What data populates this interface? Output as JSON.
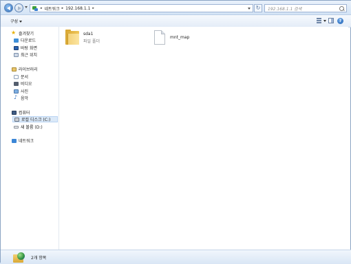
{
  "address": {
    "crumbs": [
      "네트워크",
      "192.168.1.1"
    ],
    "search_placeholder": "192.168.1.1 검색"
  },
  "toolbar": {
    "organize_label": "구성"
  },
  "sidebar": {
    "favorites": {
      "label": "즐겨찾기",
      "items": [
        {
          "label": "다운로드",
          "icon": "download-icon"
        },
        {
          "label": "바탕 화면",
          "icon": "desktop-icon"
        },
        {
          "label": "최근 위치",
          "icon": "recent-places-icon"
        }
      ]
    },
    "libraries": {
      "label": "라이브러리",
      "items": [
        {
          "label": "문서",
          "icon": "documents-icon"
        },
        {
          "label": "비디오",
          "icon": "video-icon"
        },
        {
          "label": "사진",
          "icon": "pictures-icon"
        },
        {
          "label": "음악",
          "icon": "music-icon"
        }
      ]
    },
    "computer": {
      "label": "컴퓨터",
      "items": [
        {
          "label": "로컬 디스크 (C:)",
          "icon": "local-disk-icon",
          "selected": true
        },
        {
          "label": "새 볼륨 (D:)",
          "icon": "volume-icon"
        }
      ]
    },
    "network": {
      "label": "네트워크"
    }
  },
  "content": {
    "items": [
      {
        "name": "sda1",
        "type": "파일 폴더",
        "icon": "folder-icon"
      },
      {
        "name": "mnt_map",
        "type": "",
        "icon": "file-icon"
      }
    ]
  },
  "status": {
    "count": "2개 항목"
  }
}
